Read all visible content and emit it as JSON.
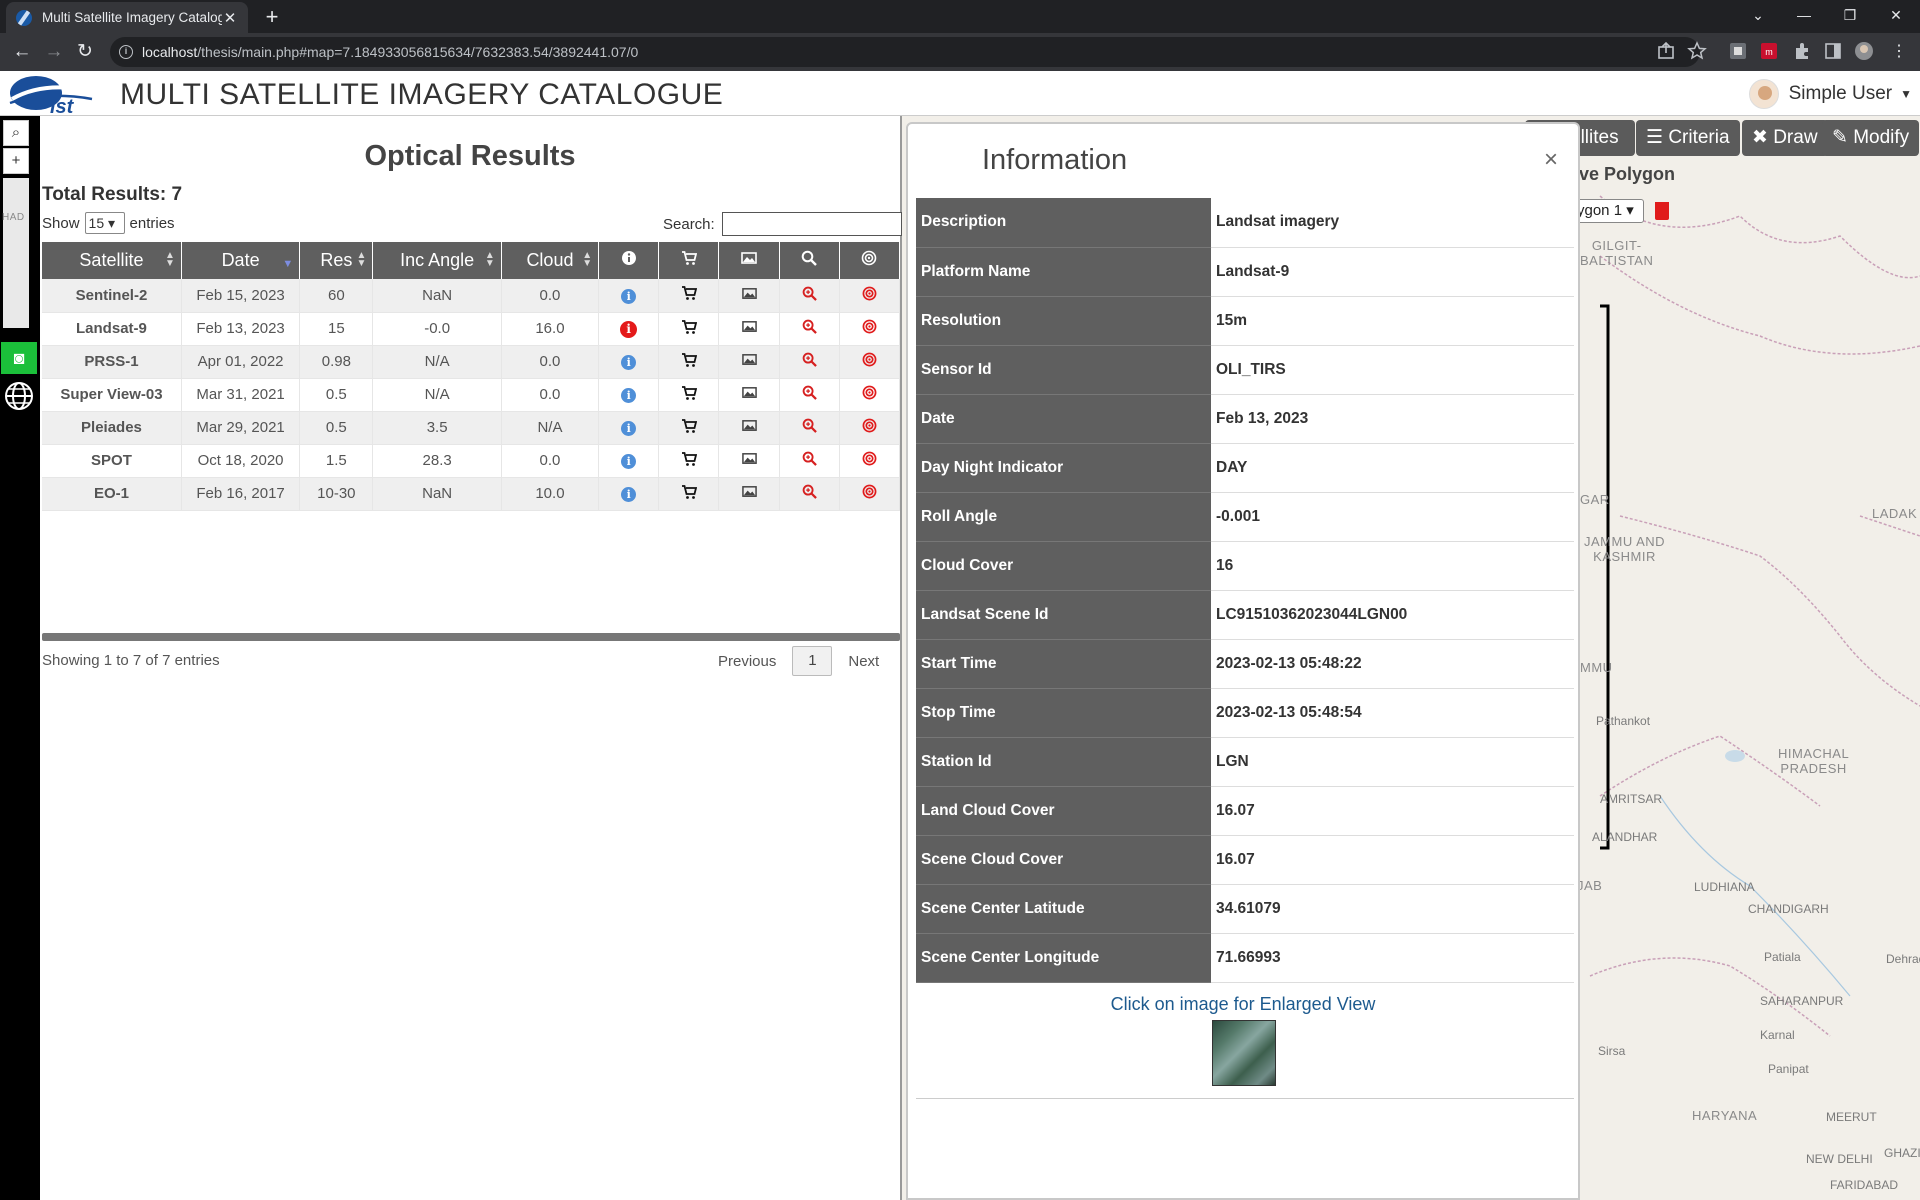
{
  "browser": {
    "tab_title": "Multi Satellite Imagery Catalogue",
    "tab_close": "✕",
    "new_tab": "+",
    "url_host": "localhost",
    "url_path": "/thesis/main.php#map=7.184933056815634/7632383.54/3892441.07/0"
  },
  "app": {
    "logo_text": "ist",
    "title": "MULTI SATELLITE IMAGERY CATALOGUE",
    "user_name": "Simple User"
  },
  "left_toolbar": {
    "search_glyph": "⌕",
    "zoom_in_glyph": "+"
  },
  "map_controls": {
    "satellites_label": "ellites",
    "criteria_label": "Criteria",
    "draw_label": "Draw",
    "modify_label": "Modify",
    "polygon_title": "ive Polygon",
    "polygon_select": "ygon 1"
  },
  "map_labels": {
    "gilgit": "GILGIT-\nBALTISTAN",
    "jammu": "JAMMU AND\nKASHMIR",
    "ladakh": "LADAK",
    "himachal": "HIMACHAL\nPRADESH",
    "punjab": "PUNJAB",
    "haryana": "HARYANA",
    "gar": "GAR",
    "mmu": "MMU",
    "had": "HAD",
    "cities": [
      "Pathankot",
      "AMRITSAR",
      "ALANDHAR",
      "LUDHIANA",
      "CHANDIGARH",
      "Patiala",
      "Dehrad",
      "SAHARANPUR",
      "Karnal",
      "Sirsa",
      "Panipat",
      "MEERUT",
      "NEW DELHI",
      "GHAZI",
      "FARIDABAD"
    ]
  },
  "results": {
    "title": "Optical Results",
    "total": "Total Results: 7",
    "show_label": "Show",
    "entries_value": "15",
    "entries_label": "entries",
    "search_label": "Search:",
    "search_value": "",
    "columns": [
      "Satellite",
      "Date",
      "Res",
      "Inc Angle",
      "Cloud"
    ],
    "rows": [
      {
        "satellite": "Sentinel-2",
        "date": "Feb 15, 2023",
        "res": "60",
        "inc_angle": "NaN",
        "cloud": "0.0",
        "selected": false
      },
      {
        "satellite": "Landsat-9",
        "date": "Feb 13, 2023",
        "res": "15",
        "inc_angle": "-0.0",
        "cloud": "16.0",
        "selected": true
      },
      {
        "satellite": "PRSS-1",
        "date": "Apr 01, 2022",
        "res": "0.98",
        "inc_angle": "N/A",
        "cloud": "0.0",
        "selected": false
      },
      {
        "satellite": "Super View-03",
        "date": "Mar 31, 2021",
        "res": "0.5",
        "inc_angle": "N/A",
        "cloud": "0.0",
        "selected": false
      },
      {
        "satellite": "Pleiades",
        "date": "Mar 29, 2021",
        "res": "0.5",
        "inc_angle": "3.5",
        "cloud": "N/A",
        "selected": false
      },
      {
        "satellite": "SPOT",
        "date": "Oct 18, 2020",
        "res": "1.5",
        "inc_angle": "28.3",
        "cloud": "0.0",
        "selected": false
      },
      {
        "satellite": "EO-1",
        "date": "Feb 16, 2017",
        "res": "10-30",
        "inc_angle": "NaN",
        "cloud": "10.0",
        "selected": false
      }
    ],
    "showing": "Showing 1 to 7 of 7 entries",
    "prev_label": "Previous",
    "page": "1",
    "next_label": "Next"
  },
  "info": {
    "title": "Information",
    "close": "×",
    "fields": [
      {
        "key": "Description",
        "value": "Landsat imagery"
      },
      {
        "key": "Platform Name",
        "value": "Landsat-9"
      },
      {
        "key": "Resolution",
        "value": "15m"
      },
      {
        "key": "Sensor Id",
        "value": "OLI_TIRS"
      },
      {
        "key": "Date",
        "value": "Feb 13, 2023"
      },
      {
        "key": "Day Night Indicator",
        "value": "DAY"
      },
      {
        "key": "Roll Angle",
        "value": "-0.001"
      },
      {
        "key": "Cloud Cover",
        "value": "16"
      },
      {
        "key": "Landsat Scene Id",
        "value": "LC91510362023044LGN00"
      },
      {
        "key": "Start Time",
        "value": "2023-02-13 05:48:22"
      },
      {
        "key": "Stop Time",
        "value": "2023-02-13 05:48:54"
      },
      {
        "key": "Station Id",
        "value": "LGN"
      },
      {
        "key": "Land Cloud Cover",
        "value": "16.07"
      },
      {
        "key": "Scene Cloud Cover",
        "value": "16.07"
      },
      {
        "key": "Scene Center Latitude",
        "value": "34.61079"
      },
      {
        "key": "Scene Center Longitude",
        "value": "71.66993"
      }
    ],
    "enlarge_label": "Click on image for Enlarged View"
  },
  "colors": {
    "header_gray": "#5f5f5f",
    "info_blue": "#4f8fd8",
    "action_red": "#e41a1a",
    "camera_green": "#1bbf3a"
  }
}
